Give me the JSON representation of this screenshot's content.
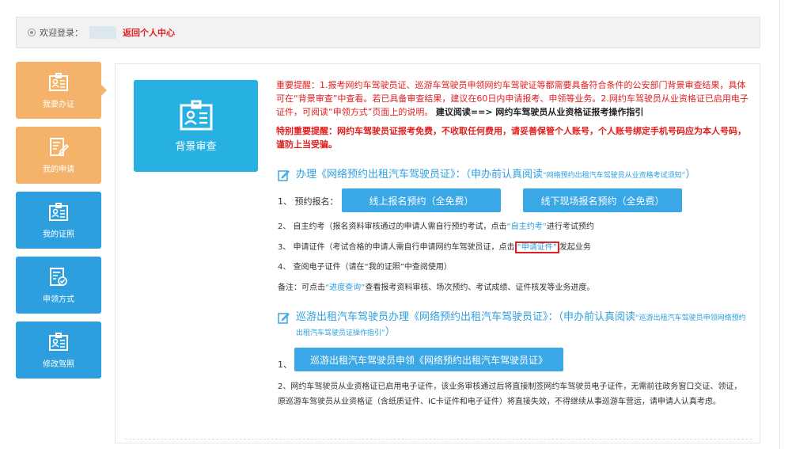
{
  "header": {
    "welcome_label": "欢迎登录：",
    "return_link": "返回个人中心"
  },
  "sidebar": {
    "items": [
      {
        "label": "我要办证",
        "icon": "id-card-icon"
      },
      {
        "label": "我的申请",
        "icon": "edit-document-icon"
      },
      {
        "label": "我的证照",
        "icon": "id-card-icon"
      },
      {
        "label": "申领方式",
        "icon": "checklist-icon"
      },
      {
        "label": "修改驾照",
        "icon": "id-card-icon"
      }
    ]
  },
  "main": {
    "tile_label": "背景审查",
    "notice": "重要提醒：1.报考网约车驾驶员证、巡游车驾驶员申领网约车驾驶证等都需要具备符合条件的公安部门背景审查结果，具体可在“背景审查”中查看。若已具备审查结果，建议在60日内申请报考、申领等业务。2.网约车驾驶员从业资格证已启用电子证件，可阅读“申领方式”页面上的说明。",
    "notice_link": "建议阅读==> 网约车驾驶员从业资格证报考操作指引",
    "notice2": "特别重要提醒：网约车驾驶员证报考免费，不收取任何费用，请妥善保管个人账号，个人账号绑定手机号码应为本人号码，谨防上当受骗。",
    "section1": {
      "title": "办理《网络预约出租汽车驾驶员证》：（申办前认真阅读",
      "title_link": "“网络预约出租汽车驾驶员从业资格考试须知”",
      "title_end": "）",
      "step1_label": "1、 预约报名：",
      "btn_online": "线上报名预约（全免费）",
      "btn_offline": "线下现场报名预约（全免费）",
      "step2_text": "2、 自主约考（报名资料审核通过的申请人需自行预约考试，点击",
      "step2_link": "“自主约考”",
      "step2_end": "进行考试预约",
      "step3_text": "3、 申请证件（考试合格的申请人需自行申请网约车驾驶员证，点击",
      "step3_link": "“申请证件”",
      "step3_end": "发起业务",
      "step4_text": "4、 查阅电子证件（请在“我的证照”中查阅使用）",
      "note_text": "备注：可点击",
      "note_link": "“进度查询”",
      "note_end": "查看报考资料审核、场次预约、考试成绩、证件核发等业务进度。"
    },
    "section2": {
      "title": "巡游出租汽车驾驶员办理《网络预约出租汽车驾驶员证》：（申办前认真阅读",
      "title_link": "“巡游出租汽车驾驶员申领网络预约出租汽车驾驶员证操作指引”",
      "title_end": "）",
      "step1_label": "1、",
      "btn_apply": "巡游出租汽车驾驶员申领《网络预约出租汽车驾驶员证》",
      "step2_text": "2、网约车驾驶员从业资格证已启用电子证件，该业务审核通过后将直接制签网约车驾驶员电子证件，无需前往政务窗口交证、领证，原巡游车驾驶员从业资格证（含纸质证件、IC卡证件和电子证件）将直接失效，不得继续从事巡游车营运，请申请人认真考虑。"
    }
  },
  "colors": {
    "accent_blue": "#2e9fde",
    "accent_orange": "#f5b26a",
    "alert_red": "#e02020"
  }
}
